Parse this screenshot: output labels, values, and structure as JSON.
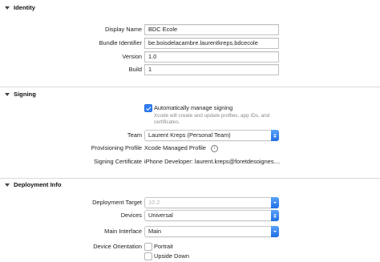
{
  "identity": {
    "title": "Identity",
    "display_name": {
      "label": "Display Name",
      "value": "BDC Ecole"
    },
    "bundle_identifier": {
      "label": "Bundle Identifier",
      "value": "be.boisdelacambre.laurentkreps.bdcecole"
    },
    "version": {
      "label": "Version",
      "value": "1.0"
    },
    "build": {
      "label": "Build",
      "value": "1"
    }
  },
  "signing": {
    "title": "Signing",
    "auto_manage": {
      "label": "Automatically manage signing",
      "checked": true,
      "note": "Xcode will create and update profiles, app IDs, and certificates."
    },
    "team": {
      "label": "Team",
      "value": "Laurent Kreps (Personal Team)"
    },
    "provisioning_profile": {
      "label": "Provisioning Profile",
      "value": "Xcode Managed Profile",
      "icon": "info-icon"
    },
    "signing_certificate": {
      "label": "Signing Certificate",
      "value": "iPhone Developer: laurent.kreps@foretdesoignes...."
    }
  },
  "deployment": {
    "title": "Deployment Info",
    "deployment_target": {
      "label": "Deployment Target",
      "value": "10.2"
    },
    "devices": {
      "label": "Devices",
      "value": "Universal"
    },
    "main_interface": {
      "label": "Main Interface",
      "value": "Main"
    },
    "device_orientation": {
      "label": "Device Orientation",
      "options": [
        {
          "label": "Portrait",
          "checked": false
        },
        {
          "label": "Upside Down",
          "checked": false
        }
      ]
    }
  },
  "colors": {
    "accent": "#2f7cf6",
    "divider": "#d9d9d9",
    "note": "#8a8a8a"
  }
}
